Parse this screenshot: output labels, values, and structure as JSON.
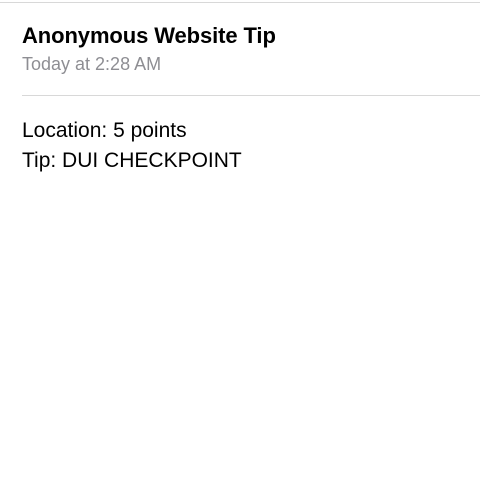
{
  "message": {
    "subject": "Anonymous Website Tip",
    "timestamp": "Today at 2:28 AM",
    "body_lines": [
      "Location: 5 points",
      "Tip: DUI CHECKPOINT"
    ]
  },
  "colors": {
    "timestamp": "#8e8e93",
    "divider": "#d8d8d8",
    "text": "#000000",
    "background": "#ffffff"
  }
}
